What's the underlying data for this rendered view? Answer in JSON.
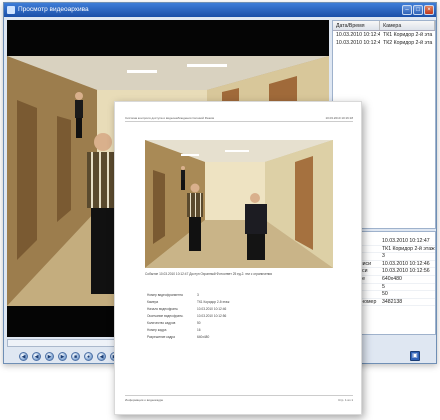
{
  "window": {
    "title": "Просмотр видеоархива",
    "buttons": {
      "minimize": "–",
      "maximize": "□",
      "close": "×"
    }
  },
  "events_table": {
    "columns": [
      "Дата/Время",
      "Камера"
    ],
    "rows": [
      [
        "10.03.2010 10:12:47",
        "ТК1 Коридор 2-й эта"
      ],
      [
        "10.03.2010 10:12:47",
        "ТК2 Коридор 2-й эта"
      ]
    ]
  },
  "properties": [
    {
      "key": "Время",
      "value": "10.03.2010 10:12:47"
    },
    {
      "key": "Камера",
      "value": "ТК1 Коридор 2-й этаж"
    },
    {
      "key": "Объект",
      "value": "3"
    },
    {
      "key": "Начало записи",
      "value": "10.03.2010 10:12:46"
    },
    {
      "key": "Конец записи",
      "value": "10.03.2010 10:12:56"
    },
    {
      "key": "Разрешение",
      "value": "640х480"
    },
    {
      "key": "Канал",
      "value": "5"
    },
    {
      "key": "Кадров",
      "value": "50"
    },
    {
      "key": "Серийный номер",
      "value": "3482138"
    }
  ],
  "controls": {
    "save_icon": "save-icon",
    "glyphs": [
      "◀",
      "◀",
      "▶",
      "▶",
      "■",
      "●",
      "◀",
      "▶",
      "‖",
      "▶"
    ]
  },
  "report": {
    "header_left": "Система контроля доступа и видеонаблюдения Сетевой Режим",
    "header_right": "10.03.2010 10:16:18",
    "caption": "Событие 10.03.2010 10:12:47 Доступ Охранный Фотоответ 25 ед.2. эти с ограничения",
    "params": [
      {
        "key": "Номер видеофрагмента",
        "value": "3"
      },
      {
        "key": "Камера",
        "value": "ТК1 Коридор 2-й этаж"
      },
      {
        "key": "Начало видеофрагм.",
        "value": "10.03.2010 10:12:46"
      },
      {
        "key": "Окончание видеофрагм.",
        "value": "10.03.2010 10:12:56"
      },
      {
        "key": "Количество кадров",
        "value": "50"
      },
      {
        "key": "Номер кадра",
        "value": "16"
      },
      {
        "key": "Разрешение кадра",
        "value": "640х480"
      }
    ],
    "footer_left": "Информация о видеокадре",
    "footer_right": "Стр. 1 из 1"
  },
  "colors": {
    "title_bar": "#1b4fa8",
    "window_bg": "#dfe7f2",
    "video_bg": "#050505"
  }
}
